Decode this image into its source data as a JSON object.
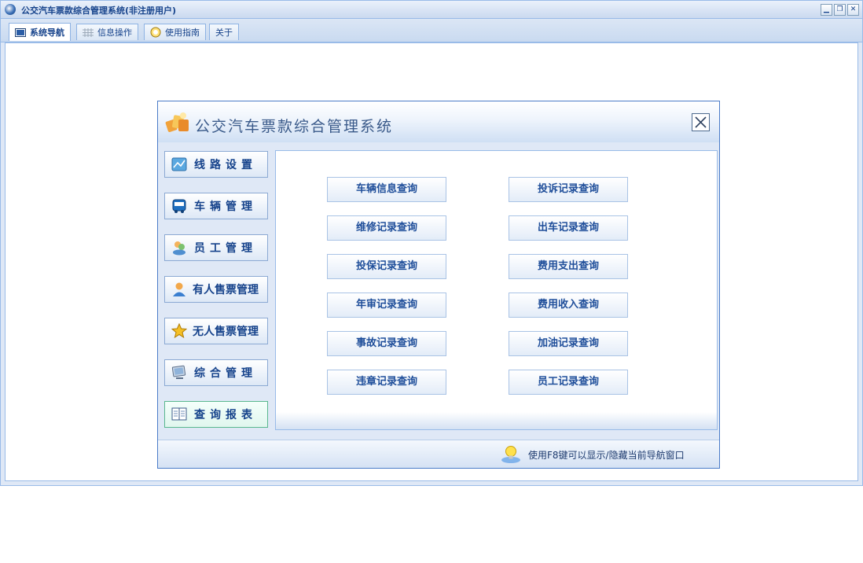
{
  "window": {
    "title": "公交汽车票款综合管理系统(非注册用户)"
  },
  "tabs": [
    {
      "label": "系统导航",
      "icon": "navigation-icon"
    },
    {
      "label": "信息操作",
      "icon": "grid-icon"
    },
    {
      "label": "使用指南",
      "icon": "guide-icon"
    },
    {
      "label": "关于",
      "icon": ""
    }
  ],
  "dialog": {
    "title": "公交汽车票款综合管理系统",
    "close_label": "✕",
    "footer_hint": "使用F8键可以显示/隐藏当前导航窗口"
  },
  "nav": [
    {
      "label": "线路设置",
      "icon": "route-icon"
    },
    {
      "label": "车辆管理",
      "icon": "bus-icon"
    },
    {
      "label": "员工管理",
      "icon": "staff-icon"
    },
    {
      "label": "有人售票管理",
      "icon": "ticket-seller-icon"
    },
    {
      "label": "无人售票管理",
      "icon": "star-icon"
    },
    {
      "label": "综合管理",
      "icon": "monitor-icon"
    },
    {
      "label": "查询报表",
      "icon": "report-icon"
    }
  ],
  "queries": {
    "left": [
      "车辆信息查询",
      "维修记录查询",
      "投保记录查询",
      "年审记录查询",
      "事故记录查询",
      "违章记录查询"
    ],
    "right": [
      "投诉记录查询",
      "出车记录查询",
      "费用支出查询",
      "费用收入查询",
      "加油记录查询",
      "员工记录查询"
    ]
  },
  "colors": {
    "accent": "#15428b",
    "border": "#99bbe8",
    "active_nav_border": "#58b78e"
  }
}
